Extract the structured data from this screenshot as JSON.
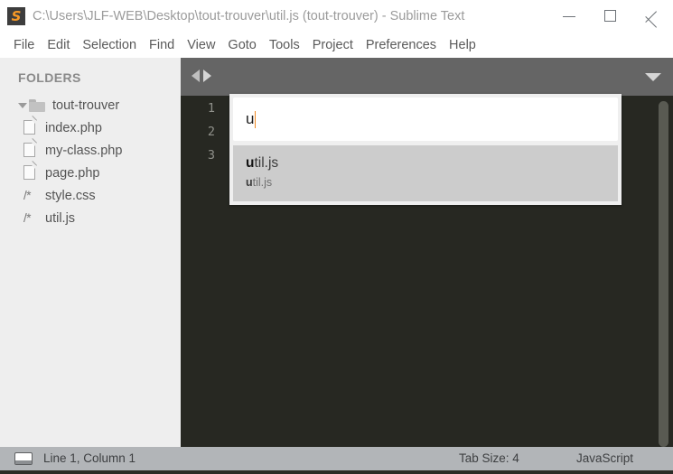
{
  "window": {
    "title": "C:\\Users\\JLF-WEB\\Desktop\\tout-trouver\\util.js (tout-trouver) - Sublime Text",
    "logo_glyph": "S",
    "controls": {
      "minimize": "minimize",
      "maximize": "maximize",
      "close": "close"
    }
  },
  "menubar": {
    "items": [
      {
        "label": "File"
      },
      {
        "label": "Edit"
      },
      {
        "label": "Selection"
      },
      {
        "label": "Find"
      },
      {
        "label": "View"
      },
      {
        "label": "Goto"
      },
      {
        "label": "Tools"
      },
      {
        "label": "Project"
      },
      {
        "label": "Preferences"
      },
      {
        "label": "Help"
      }
    ]
  },
  "sidebar": {
    "header": "FOLDERS",
    "folder": {
      "name": "tout-trouver",
      "expanded": true
    },
    "files": [
      {
        "name": "index.php",
        "icon": "file-page-icon",
        "icon_text": ""
      },
      {
        "name": "my-class.php",
        "icon": "file-page-icon",
        "icon_text": ""
      },
      {
        "name": "page.php",
        "icon": "file-page-icon",
        "icon_text": ""
      },
      {
        "name": "style.css",
        "icon": "file-code-icon",
        "icon_text": "/*"
      },
      {
        "name": "util.js",
        "icon": "file-code-icon",
        "icon_text": "/*"
      }
    ]
  },
  "tabbar": {
    "nav_back": "◀",
    "nav_forward": "▶",
    "dropdown": "▼"
  },
  "editor": {
    "line_numbers": [
      "1",
      "2",
      "3"
    ],
    "content": ""
  },
  "goto_panel": {
    "input_value": "u",
    "results": [
      {
        "primary_match": "u",
        "primary_rest": "til.js",
        "secondary_match": "u",
        "secondary_rest": "til.js",
        "selected": true
      }
    ]
  },
  "statusbar": {
    "console_icon": "console-icon",
    "position": "Line 1, Column 1",
    "tab_size": "Tab Size: 4",
    "syntax": "JavaScript"
  },
  "colors": {
    "editor_bg": "#272822",
    "sidebar_bg": "#eeeeee",
    "tabbar_bg": "#656565",
    "statusbar_bg": "#b2b5b8",
    "accent_orange": "#f89a26",
    "selected_row": "#cccccc"
  }
}
